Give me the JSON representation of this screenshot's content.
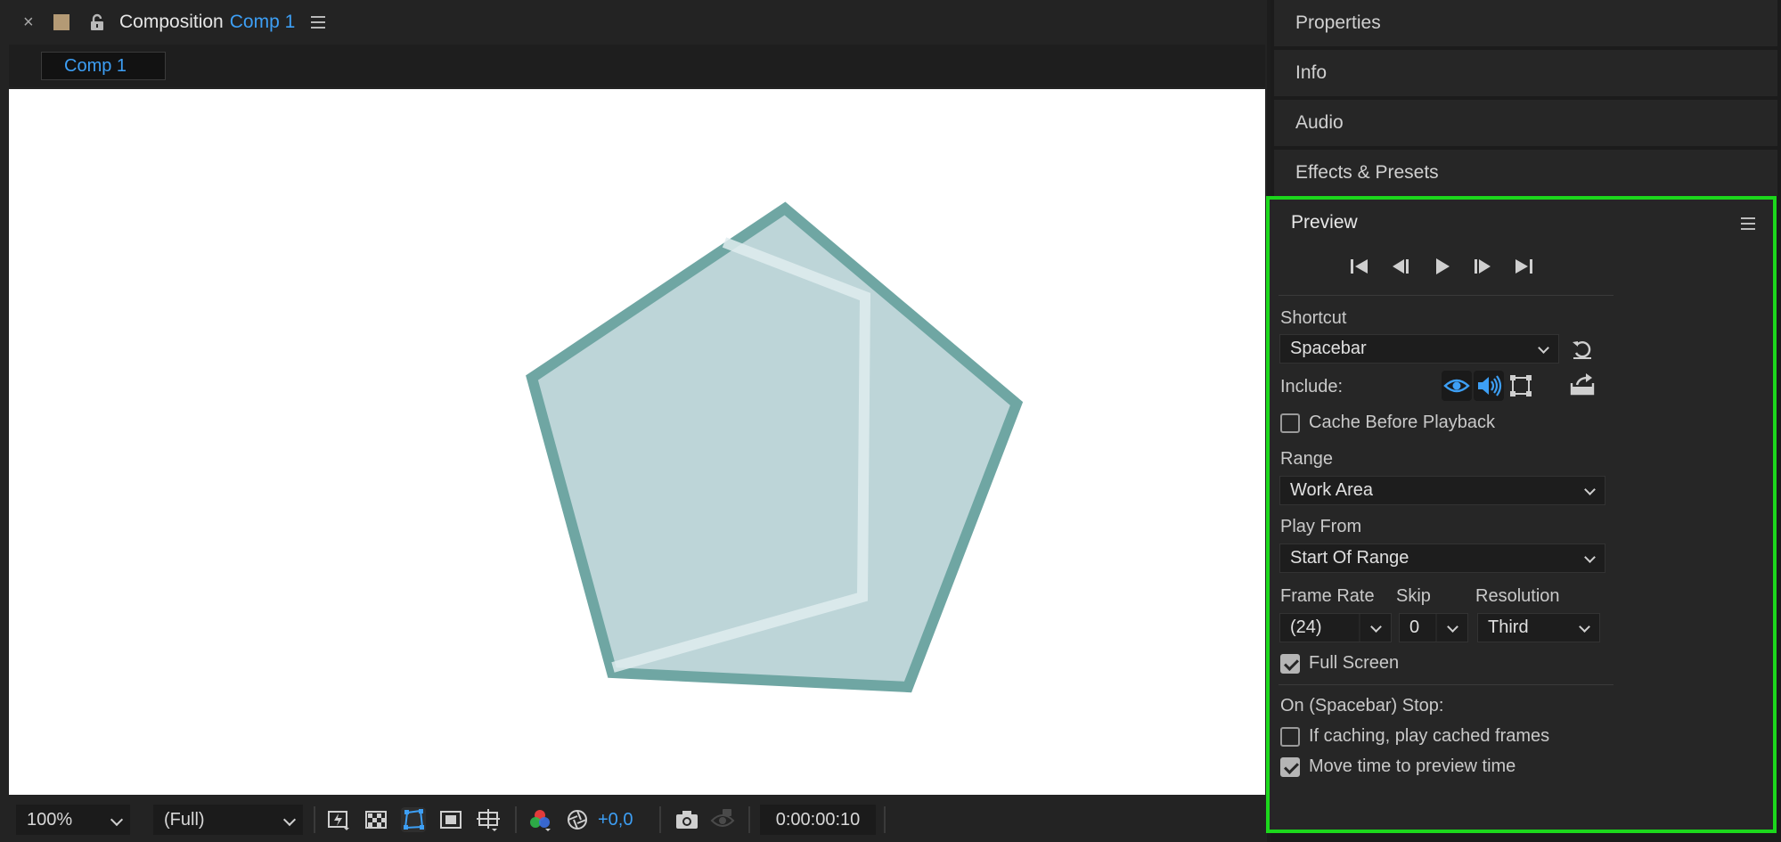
{
  "composition": {
    "panel_title": "Composition",
    "comp_name": "Comp 1",
    "tab_label": "Comp 1",
    "colors": {
      "accent": "#3d9ff5",
      "shape_fill": "#bdd5d8",
      "shape_stroke": "#6fa6a3",
      "highlight": "#dfecee"
    }
  },
  "footer": {
    "zoom": "100%",
    "resolution": "(Full)",
    "exposure": "+0,0",
    "timecode": "0:00:00:10"
  },
  "panels": {
    "properties": "Properties",
    "info": "Info",
    "audio": "Audio",
    "effects": "Effects & Presets"
  },
  "preview": {
    "title": "Preview",
    "shortcut_label": "Shortcut",
    "shortcut_value": "Spacebar",
    "include_label": "Include:",
    "cache_before_playback": {
      "label": "Cache Before Playback",
      "checked": false
    },
    "range_label": "Range",
    "range_value": "Work Area",
    "play_from_label": "Play From",
    "play_from_value": "Start Of Range",
    "frame_rate_label": "Frame Rate",
    "frame_rate_value": "(24)",
    "skip_label": "Skip",
    "skip_value": "0",
    "resolution_label": "Resolution",
    "resolution_value": "Third",
    "full_screen": {
      "label": "Full Screen",
      "checked": true
    },
    "stop_label": "On (Spacebar) Stop:",
    "if_caching": {
      "label": "If caching, play cached frames",
      "checked": false
    },
    "move_time": {
      "label": "Move time to preview time",
      "checked": true
    },
    "highlight_color": "#1cd71c"
  }
}
